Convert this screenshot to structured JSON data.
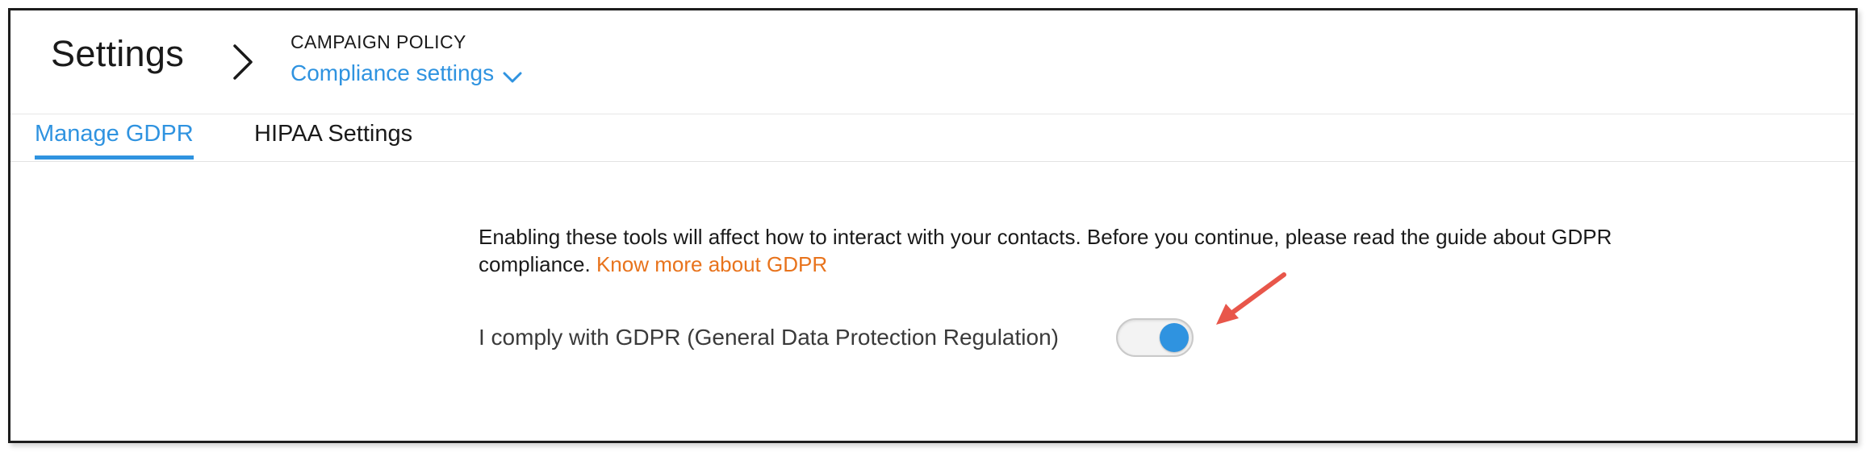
{
  "header": {
    "title": "Settings",
    "section_label": "CAMPAIGN POLICY",
    "section_dropdown": "Compliance settings"
  },
  "tabs": [
    {
      "label": "Manage GDPR",
      "active": true
    },
    {
      "label": "HIPAA Settings",
      "active": false
    }
  ],
  "gdpr": {
    "description": "Enabling these tools will affect how to interact with your contacts. Before you continue, please read the guide about GDPR compliance.",
    "link_text": "Know more about GDPR",
    "comply_label": "I comply with GDPR (General Data Protection Regulation)",
    "toggle_on": true
  },
  "colors": {
    "accent": "#2f93e0",
    "link": "#e8731c",
    "annotation_arrow": "#e8564a"
  },
  "icons": {
    "breadcrumb": "chevron-right-icon",
    "dropdown": "chevron-down-icon"
  }
}
